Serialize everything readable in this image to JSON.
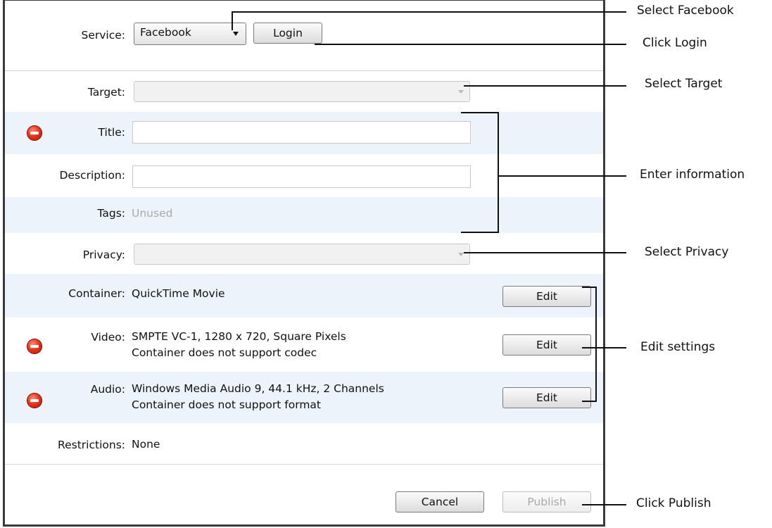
{
  "service": {
    "label": "Service:",
    "selected": "Facebook",
    "login_label": "Login"
  },
  "target": {
    "label": "Target:"
  },
  "title_field": {
    "label": "Title:",
    "value": ""
  },
  "description_field": {
    "label": "Description:",
    "value": ""
  },
  "tags": {
    "label": "Tags:",
    "value": "Unused"
  },
  "privacy": {
    "label": "Privacy:"
  },
  "container": {
    "label": "Container:",
    "value": "QuickTime Movie",
    "edit_label": "Edit"
  },
  "video": {
    "label": "Video:",
    "line1": "SMPTE VC-1, 1280 x 720, Square Pixels",
    "line2": "Container does not support codec",
    "edit_label": "Edit"
  },
  "audio": {
    "label": "Audio:",
    "line1": "Windows Media Audio 9, 44.1 kHz, 2 Channels",
    "line2": "Container does not support format",
    "edit_label": "Edit"
  },
  "restrictions": {
    "label": "Restrictions:",
    "value": "None"
  },
  "footer": {
    "cancel_label": "Cancel",
    "publish_label": "Publish"
  },
  "callouts": {
    "select_facebook": "Select Facebook",
    "click_login": "Click Login",
    "select_target": "Select Target",
    "enter_information": "Enter information",
    "select_privacy": "Select Privacy",
    "edit_settings": "Edit settings",
    "click_publish": "Click Publish"
  },
  "colors": {
    "row_highlight": "#edf3fa",
    "error": "#e0351a",
    "disabled_text": "#a9a9a9"
  }
}
